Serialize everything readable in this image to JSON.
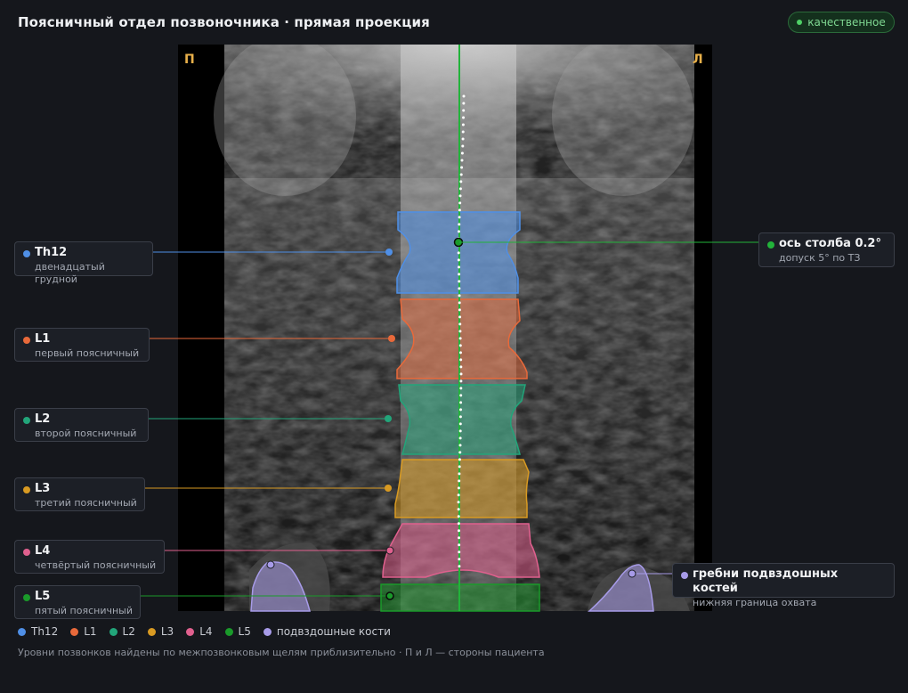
{
  "header": {
    "title": "Поясничный отдел позвоночника · прямая проекция",
    "badge": "качественное",
    "badge_color": "#4fd066"
  },
  "scan": {
    "side_right_letter": "П",
    "side_left_letter": "Л",
    "side_color": "#e8b04a",
    "axis_color": "#22b33a"
  },
  "vertebrae": [
    {
      "id": "Th12",
      "name": "Th12",
      "desc": "двенадцатый грудной",
      "color": "#4f8fe6"
    },
    {
      "id": "L1",
      "name": "L1",
      "desc": "первый поясничный",
      "color": "#e8693a"
    },
    {
      "id": "L2",
      "name": "L2",
      "desc": "второй поясничный",
      "color": "#22a57a"
    },
    {
      "id": "L3",
      "name": "L3",
      "desc": "третий поясничный",
      "color": "#d89a22"
    },
    {
      "id": "L4",
      "name": "L4",
      "desc": "четвёртый поясничный",
      "color": "#e0608e"
    },
    {
      "id": "L5",
      "name": "L5",
      "desc": "пятый поясничный",
      "color": "#1a9a2a"
    }
  ],
  "axis_label": {
    "name": "ось столба 0.2°",
    "desc": "допуск 5° по ТЗ",
    "color": "#22b33a"
  },
  "iliac_label": {
    "name": "гребни подвздошных костей",
    "desc": "нижняя граница охвата",
    "color": "#a79be8"
  },
  "legend": [
    {
      "label": "Th12",
      "color": "#4f8fe6"
    },
    {
      "label": "L1",
      "color": "#e8693a"
    },
    {
      "label": "L2",
      "color": "#22a57a"
    },
    {
      "label": "L3",
      "color": "#d89a22"
    },
    {
      "label": "L4",
      "color": "#e0608e"
    },
    {
      "label": "L5",
      "color": "#1a9a2a"
    },
    {
      "label": "подвздошные кости",
      "color": "#a79be8"
    }
  ],
  "footnote": "Уровни позвонков найдены по межпозвонковым щелям приблизительно · П и Л — стороны пациента"
}
